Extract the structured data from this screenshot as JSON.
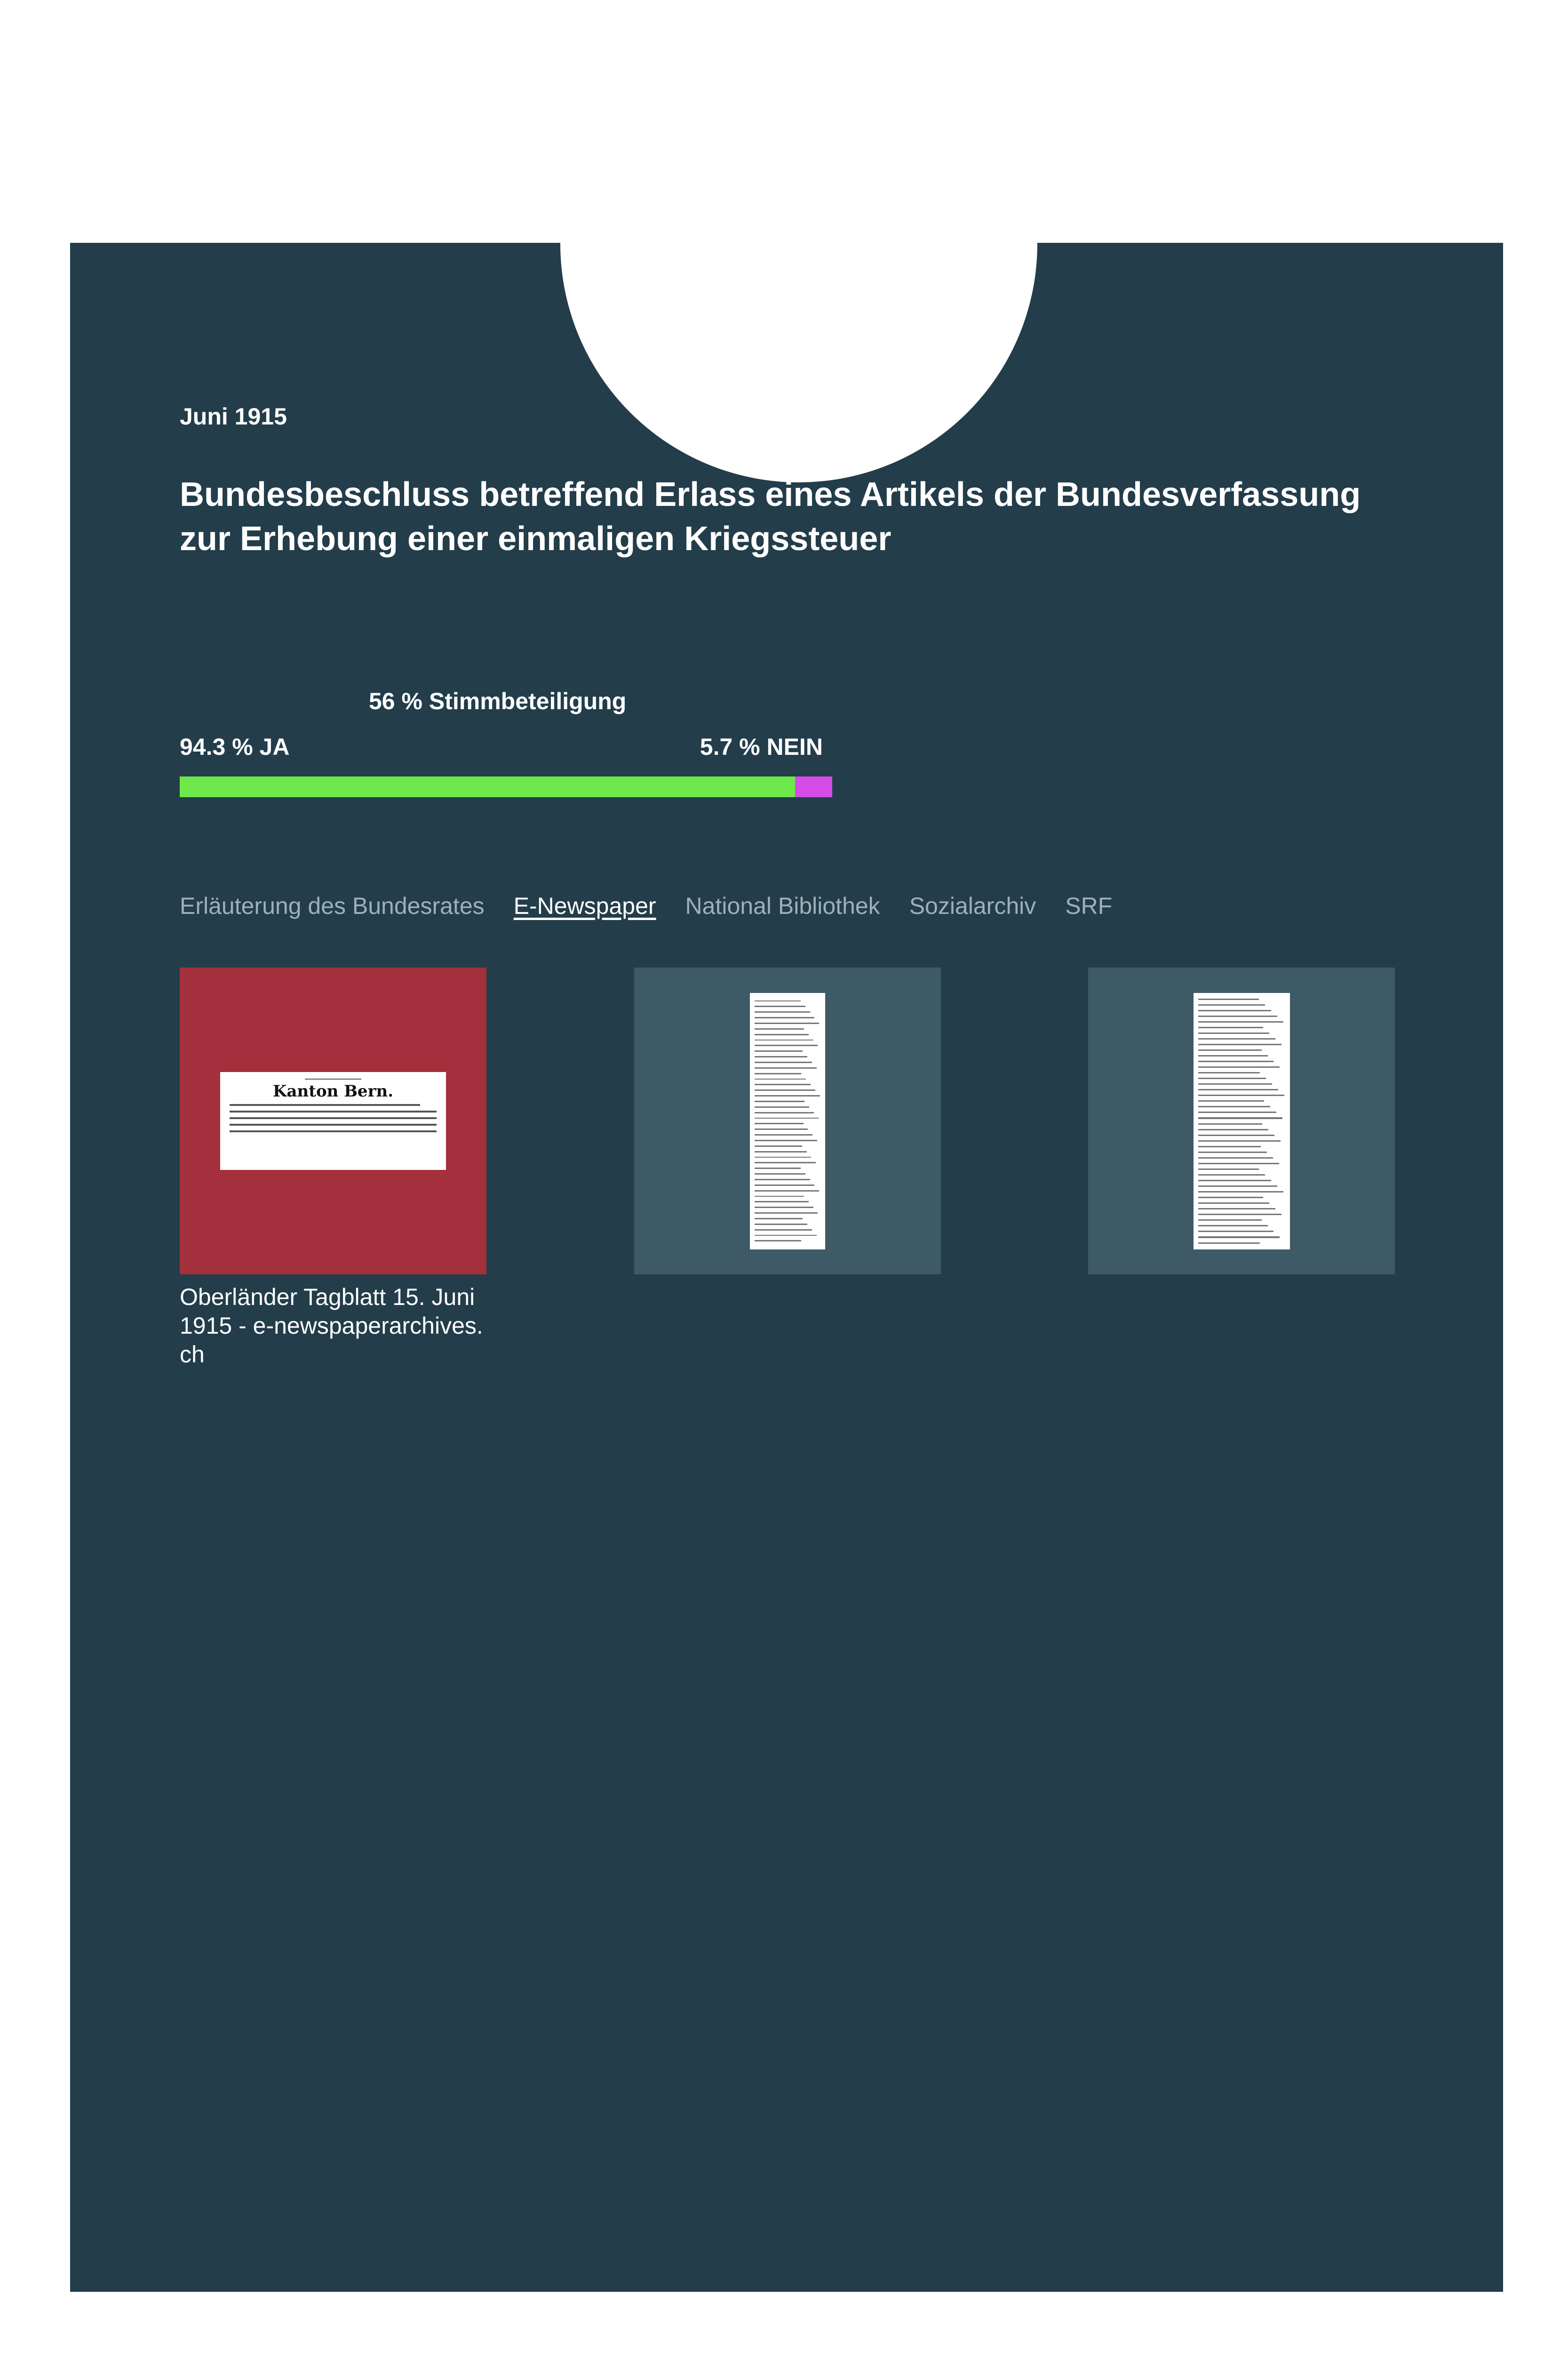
{
  "header": {
    "date": "Juni 1915",
    "title": "Bundesbeschluss betreffend Erlass eines Artikels der Bundesverfassung zur Erhebung einer einmaligen Kriegssteuer"
  },
  "results": {
    "turnout_label": "56 % Stimmbeteiligung",
    "yes_label": "94.3 % JA",
    "no_label": "5.7 % NEIN",
    "yes_percent": 94.3,
    "no_percent": 5.7,
    "yes_color": "#6ee84a",
    "no_color": "#d44be8"
  },
  "tabs": [
    {
      "label": "Erläuterung des Bundesrates",
      "active": false
    },
    {
      "label": "E-Newspaper",
      "active": true
    },
    {
      "label": "National Bibliothek",
      "active": false
    },
    {
      "label": "Sozialarchiv",
      "active": false
    },
    {
      "label": "SRF",
      "active": false
    }
  ],
  "gallery": {
    "items": [
      {
        "clipping_heading": "Kanton Bern.",
        "caption": "Oberländer Tagblatt 15. Juni 1915 - e-newspaperarchives. ch"
      },
      {},
      {}
    ]
  },
  "colors": {
    "card_background": "#233d4a",
    "thumb_highlight": "#a3303c",
    "thumb_background": "#3d5a66"
  }
}
